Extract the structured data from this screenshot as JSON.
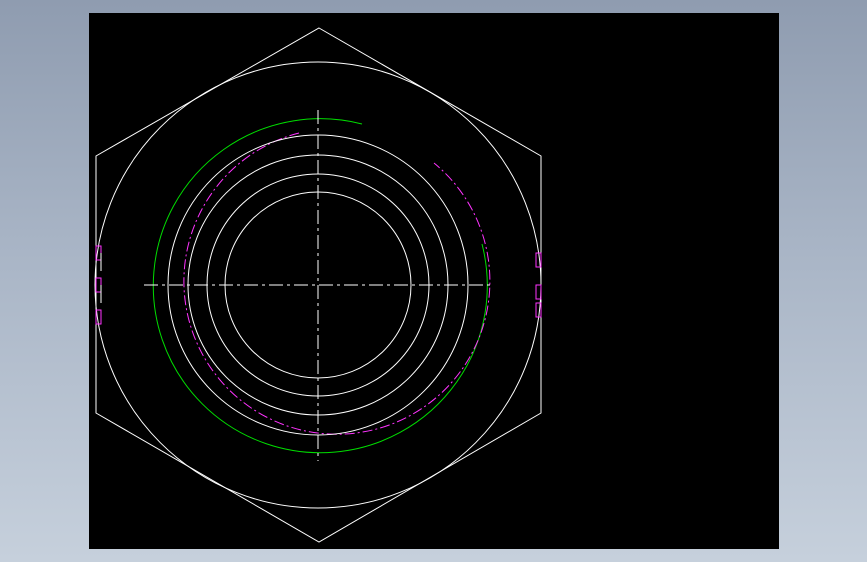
{
  "colors": {
    "background_gradient_top": "#8f9cb0",
    "background_gradient_bottom": "#c6d0dc",
    "viewport_background": "#000000",
    "outline": "#ffffff",
    "thread_major": "#00ff00",
    "thread_hidden": "#ff00ff",
    "centerline": "#ffffff"
  },
  "drawing": {
    "view": "top view",
    "part": "hex nut",
    "elements": [
      "hexagon-outline",
      "chamfer-circle",
      "thread-major-arc",
      "thread-hidden-arc",
      "concentric-circles",
      "horizontal-centerline",
      "vertical-centerline",
      "edge-detail-marks"
    ],
    "concentric_circle_count": 4
  }
}
